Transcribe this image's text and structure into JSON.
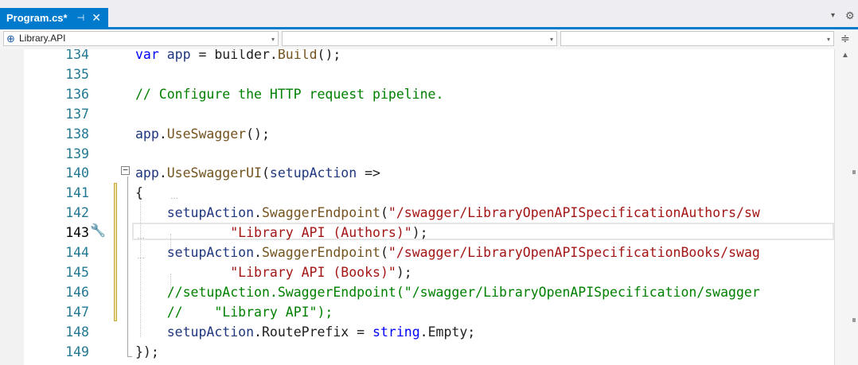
{
  "tab": {
    "title": "Program.cs*",
    "pin_icon": "pin-icon",
    "pin_glyph": "⊣",
    "close_icon": "close-icon",
    "close_glyph": "✕",
    "accent_color": "#007acc"
  },
  "tabstrip": {
    "dropdown_glyph": "▾",
    "settings_glyph": "⚙"
  },
  "navbar": {
    "project": "Library.API",
    "type": "",
    "member": "",
    "caret": "▾",
    "split_glyph": "≑"
  },
  "editor": {
    "current_line": "143",
    "quick_action_glyph": "🔧",
    "scroll_up_glyph": "▲",
    "lines": [
      {
        "number": "134",
        "tokens": [
          [
            "keyword",
            "var"
          ],
          [
            "plain",
            " "
          ],
          [
            "param",
            "app"
          ],
          [
            "plain",
            " = builder."
          ],
          [
            "method",
            "Build"
          ],
          [
            "plain",
            "();"
          ]
        ]
      },
      {
        "number": "135",
        "tokens": []
      },
      {
        "number": "136",
        "tokens": [
          [
            "comment",
            "// Configure the HTTP request pipeline."
          ]
        ]
      },
      {
        "number": "137",
        "tokens": []
      },
      {
        "number": "138",
        "tokens": [
          [
            "param",
            "app"
          ],
          [
            "plain",
            "."
          ],
          [
            "method",
            "UseSwagger"
          ],
          [
            "plain",
            "();"
          ]
        ]
      },
      {
        "number": "139",
        "tokens": []
      },
      {
        "number": "140",
        "tokens": [
          [
            "param",
            "app"
          ],
          [
            "plain",
            "."
          ],
          [
            "method",
            "UseSwaggerUI"
          ],
          [
            "plain",
            "("
          ],
          [
            "param",
            "setupAction"
          ],
          [
            "plain",
            " =>"
          ]
        ]
      },
      {
        "number": "141",
        "tokens": [
          [
            "plain",
            "{"
          ]
        ]
      },
      {
        "number": "142",
        "tokens": [
          [
            "plain",
            "    "
          ],
          [
            "param",
            "setupAction"
          ],
          [
            "plain",
            "."
          ],
          [
            "method",
            "SwaggerEndpoint"
          ],
          [
            "plain",
            "("
          ],
          [
            "string",
            "\"/swagger/LibraryOpenAPISpecificationAuthors/sw"
          ]
        ]
      },
      {
        "number": "143",
        "tokens": [
          [
            "plain",
            "            "
          ],
          [
            "string",
            "\"Library API (Authors)\""
          ],
          [
            "plain",
            ");"
          ]
        ]
      },
      {
        "number": "144",
        "tokens": [
          [
            "plain",
            "    "
          ],
          [
            "param",
            "setupAction"
          ],
          [
            "plain",
            "."
          ],
          [
            "method",
            "SwaggerEndpoint"
          ],
          [
            "plain",
            "("
          ],
          [
            "string",
            "\"/swagger/LibraryOpenAPISpecificationBooks/swag"
          ]
        ]
      },
      {
        "number": "145",
        "tokens": [
          [
            "plain",
            "            "
          ],
          [
            "string",
            "\"Library API (Books)\""
          ],
          [
            "plain",
            ");"
          ]
        ]
      },
      {
        "number": "146",
        "tokens": [
          [
            "plain",
            "    "
          ],
          [
            "comment",
            "//setupAction.SwaggerEndpoint(\"/swagger/LibraryOpenAPISpecification/swagger"
          ]
        ]
      },
      {
        "number": "147",
        "tokens": [
          [
            "plain",
            "    "
          ],
          [
            "comment",
            "//    \"Library API\");"
          ]
        ]
      },
      {
        "number": "148",
        "tokens": [
          [
            "plain",
            "    "
          ],
          [
            "param",
            "setupAction"
          ],
          [
            "plain",
            ".RoutePrefix = "
          ],
          [
            "keyword",
            "string"
          ],
          [
            "plain",
            ".Empty;"
          ]
        ]
      },
      {
        "number": "149",
        "tokens": [
          [
            "plain",
            "});"
          ]
        ]
      }
    ]
  },
  "colors": {
    "keyword": "#0000ff",
    "comment": "#008000",
    "string": "#a31515",
    "method": "#74531f",
    "parameter": "#1f377f",
    "line_number": "#237893",
    "change_marker": "#efe2a5"
  }
}
